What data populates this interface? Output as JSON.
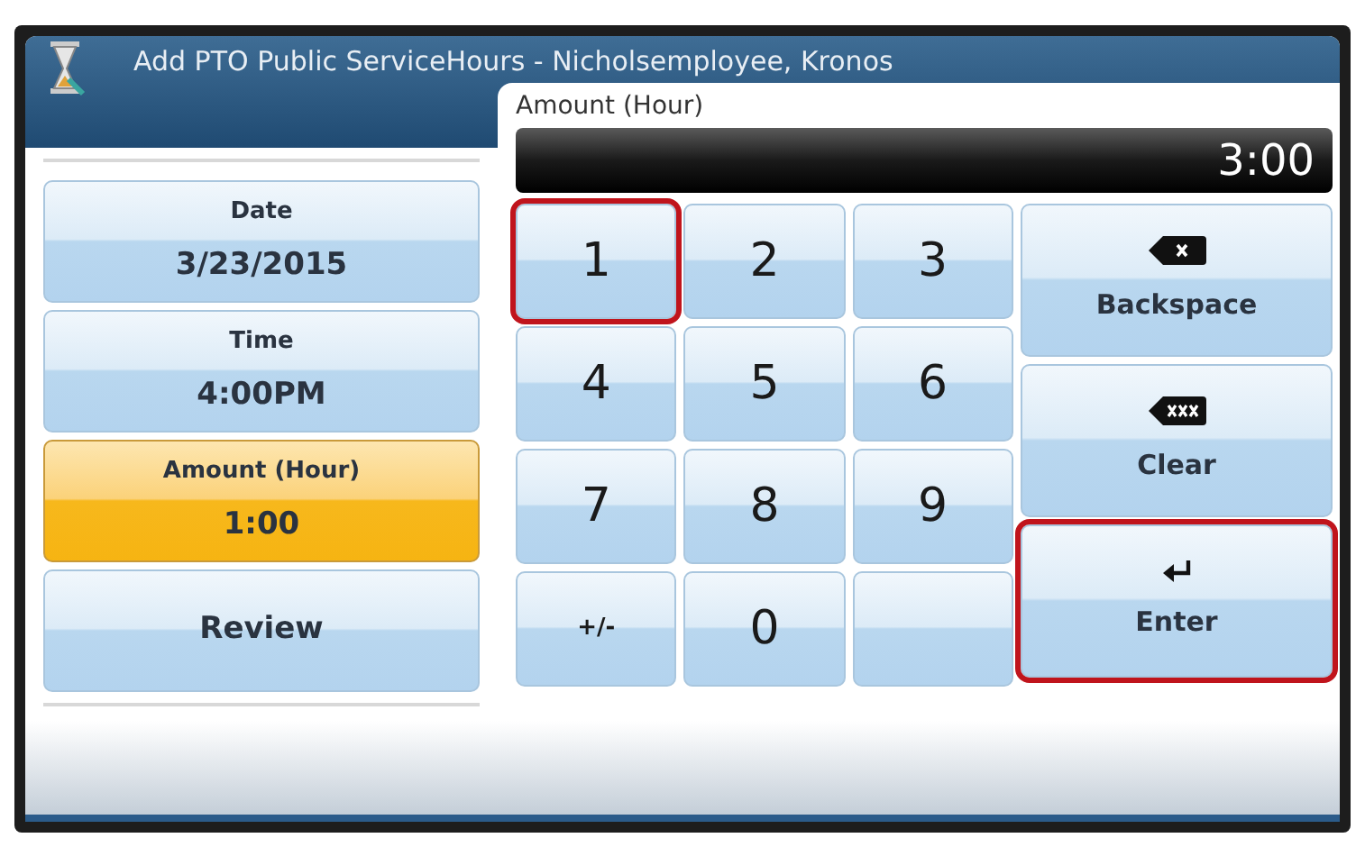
{
  "window": {
    "title": "Add PTO Public ServiceHours - Nicholsemployee, Kronos"
  },
  "sidebar": {
    "items": [
      {
        "label": "Date",
        "value": "3/23/2015",
        "selected": false
      },
      {
        "label": "Time",
        "value": "4:00PM",
        "selected": false
      },
      {
        "label": "Amount (Hour)",
        "value": "1:00",
        "selected": true
      },
      {
        "label": "Review",
        "selected": false
      }
    ]
  },
  "entry": {
    "label": "Amount (Hour)",
    "display": "3:00"
  },
  "keypad": [
    {
      "kind": "digit",
      "label": "1",
      "highlighted": true
    },
    {
      "kind": "digit",
      "label": "2",
      "highlighted": false
    },
    {
      "kind": "digit",
      "label": "3",
      "highlighted": false
    },
    {
      "kind": "digit",
      "label": "4",
      "highlighted": false
    },
    {
      "kind": "digit",
      "label": "5",
      "highlighted": false
    },
    {
      "kind": "digit",
      "label": "6",
      "highlighted": false
    },
    {
      "kind": "digit",
      "label": "7",
      "highlighted": false
    },
    {
      "kind": "digit",
      "label": "8",
      "highlighted": false
    },
    {
      "kind": "digit",
      "label": "9",
      "highlighted": false
    },
    {
      "kind": "sign",
      "label": "+/-",
      "highlighted": false
    },
    {
      "kind": "digit",
      "label": "0",
      "highlighted": false
    },
    {
      "kind": "blank",
      "highlighted": false
    }
  ],
  "actions": [
    {
      "kind": "backspace",
      "label": "Backspace",
      "highlighted": false
    },
    {
      "kind": "clear",
      "label": "Clear",
      "highlighted": false
    },
    {
      "kind": "enter",
      "label": "Enter",
      "highlighted": true
    }
  ]
}
